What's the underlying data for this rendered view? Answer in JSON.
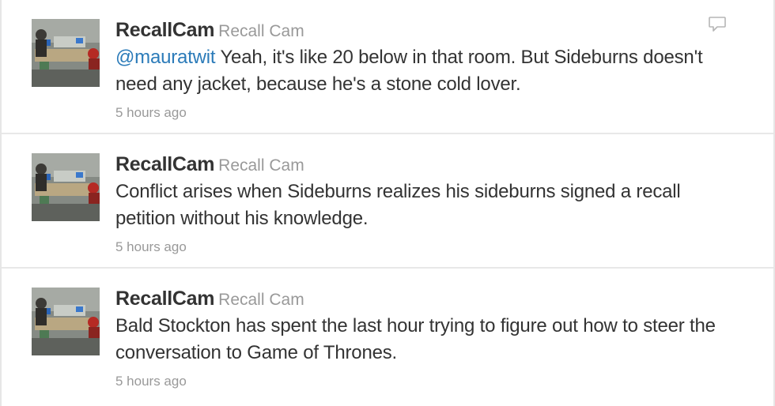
{
  "icons": {
    "reply": "speech-bubble-reply-icon",
    "avatar": "office-photo-avatar"
  },
  "colors": {
    "link": "#2b7bb9",
    "text": "#333333",
    "muted": "#999999",
    "border": "#e8e8e8"
  },
  "tweets": [
    {
      "screen_name": "RecallCam",
      "full_name": "Recall Cam",
      "mention": "@mauratwit",
      "text": " Yeah, it's like 20 below in that room. But Sideburns doesn't need any jacket, because he's a stone cold lover.",
      "time": "5 hours ago"
    },
    {
      "screen_name": "RecallCam",
      "full_name": "Recall Cam",
      "text": "Conflict arises when Sideburns realizes his sideburns signed a recall petition without his knowledge.",
      "time": "5 hours ago"
    },
    {
      "screen_name": "RecallCam",
      "full_name": "Recall Cam",
      "text": "Bald Stockton has spent the last hour trying to figure out how to steer the conversation to Game of Thrones.",
      "time": "5 hours ago"
    }
  ]
}
